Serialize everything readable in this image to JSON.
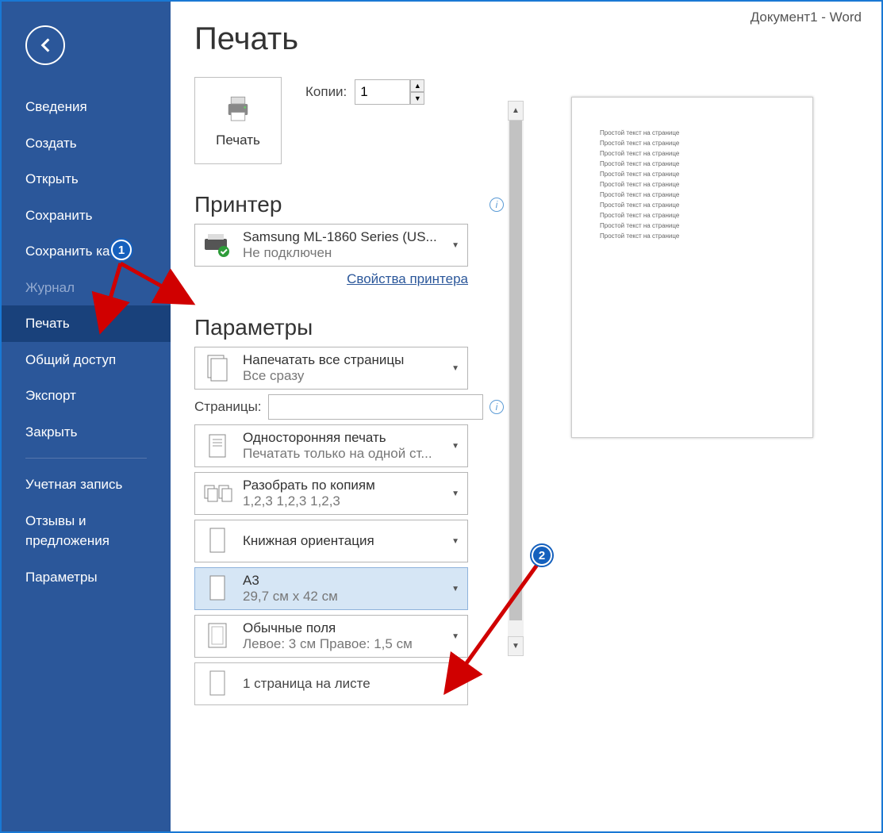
{
  "app_title": "Документ1  -  Word",
  "sidebar": {
    "items": [
      "Сведения",
      "Создать",
      "Открыть",
      "Сохранить",
      "Сохранить как",
      "Журнал",
      "Печать",
      "Общий доступ",
      "Экспорт",
      "Закрыть"
    ],
    "footer": [
      "Учетная запись",
      "Отзывы и предложения",
      "Параметры"
    ]
  },
  "print": {
    "title": "Печать",
    "button_label": "Печать",
    "copies_label": "Копии:",
    "copies_value": "1",
    "section_printer": "Принтер",
    "printer": {
      "name": "Samsung ML-1860 Series (US...",
      "status": "Не подключен"
    },
    "printer_props": "Свойства принтера",
    "section_params": "Параметры",
    "opt_pages_all": {
      "line1": "Напечатать все страницы",
      "line2": "Все сразу"
    },
    "pages_label": "Страницы:",
    "pages_value": "",
    "opt_oneside": {
      "line1": "Односторонняя печать",
      "line2": "Печатать только на одной ст..."
    },
    "opt_collate": {
      "line1": "Разобрать по копиям",
      "line2": "1,2,3    1,2,3    1,2,3"
    },
    "opt_orient": {
      "line1": "Книжная ориентация"
    },
    "opt_paper": {
      "line1": "A3",
      "line2": "29,7 см x 42 см"
    },
    "opt_margins": {
      "line1": "Обычные поля",
      "line2": "Левое:  3 см   Правое:  1,5 см"
    },
    "opt_ppsheet": {
      "line1": "1 страница на листе"
    }
  },
  "preview_line": "Простой текст на странице",
  "callouts": {
    "c1": "1",
    "c2": "2"
  }
}
